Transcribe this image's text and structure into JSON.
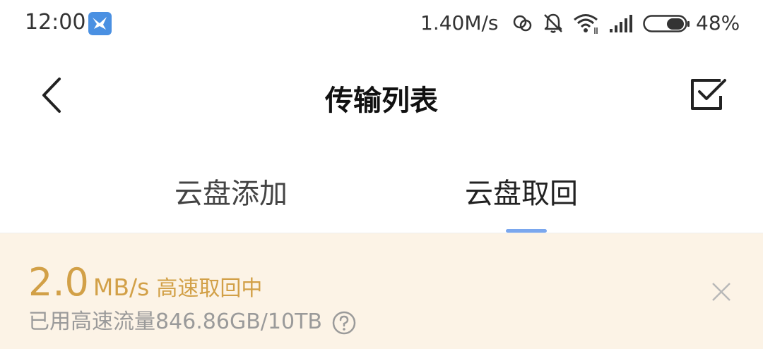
{
  "status_bar": {
    "time": "12:00",
    "network_speed": "1.40M/s",
    "battery_percent": "48%",
    "battery_level": 0.48,
    "icons": [
      "app-bird-icon",
      "sync-icon",
      "mute-bell-icon",
      "wifi-icon",
      "signal-icon",
      "battery-icon"
    ]
  },
  "header": {
    "title": "传输列表",
    "back_icon": "chevron-left-icon",
    "select_icon": "checkbox-icon"
  },
  "tabs": [
    {
      "label": "云盘添加",
      "active": false
    },
    {
      "label": "云盘取回",
      "active": true
    }
  ],
  "banner": {
    "speed_value": "2.0",
    "speed_unit": "MB/s",
    "speed_status": "高速取回中",
    "usage_text": "已用高速流量846.86GB/10TB",
    "help_icon": "question-circle-icon",
    "close_icon": "close-icon"
  },
  "colors": {
    "accent": "#7aa7ee",
    "banner_bg": "#fcf3e6",
    "speed_text": "#d2a047",
    "muted_text": "#9a9a9a"
  }
}
